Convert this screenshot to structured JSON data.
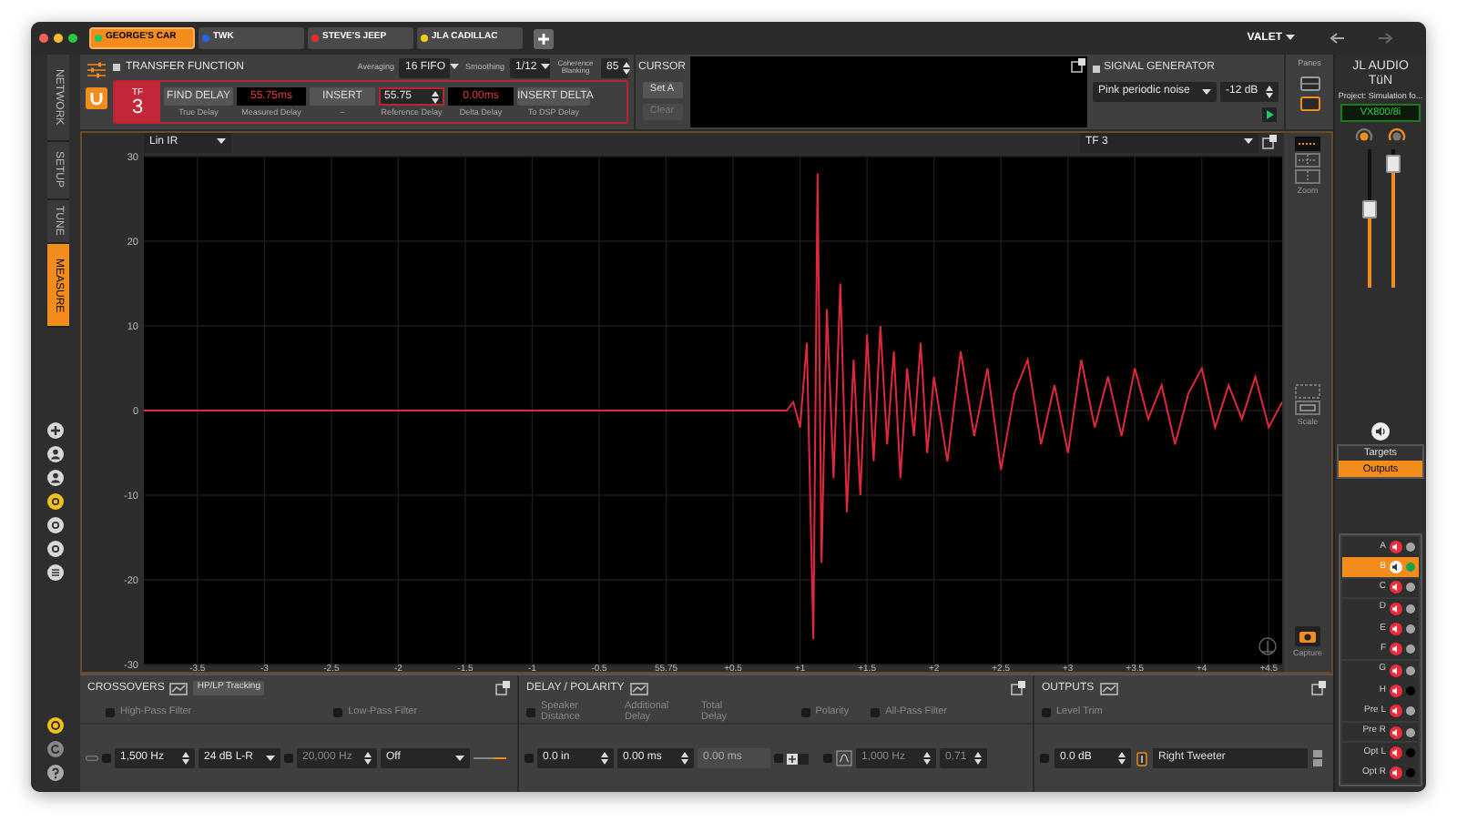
{
  "tabs": [
    {
      "label": "GEORGE'S CAR",
      "color": "#22c55e",
      "selected": true
    },
    {
      "label": "TWK",
      "color": "#2563eb",
      "selected": false
    },
    {
      "label": "STEVE'S JEEP",
      "color": "#ef2b2b",
      "selected": false
    },
    {
      "label": "JLA CADILLAC",
      "color": "#facc15",
      "selected": false
    }
  ],
  "profile": "VALET",
  "nav_tabs": [
    {
      "label": "NETWORK",
      "selected": false
    },
    {
      "label": "SETUP",
      "selected": false
    },
    {
      "label": "TUNE",
      "selected": false
    },
    {
      "label": "MEASURE",
      "selected": true
    }
  ],
  "transfer_function": {
    "title": "TRANSFER FUNCTION",
    "averaging_label": "Averaging",
    "averaging": "16 FIFO",
    "smoothing_label": "Smoothing",
    "smoothing": "1/12",
    "coherence_label": "Coherence Blanking",
    "coherence": "85",
    "tf_label": "TF",
    "tf_number": "3",
    "find_delay": {
      "label": "FIND DELAY",
      "caption": "True Delay"
    },
    "measured_delay": {
      "value": "55.75ms",
      "caption": "Measured Delay"
    },
    "insert": {
      "label": "INSERT",
      "caption": "–"
    },
    "reference_delay": {
      "value": "55.75",
      "caption": "Reference Delay"
    },
    "delta_delay": {
      "value": "0.00ms",
      "caption": "Delta Delay"
    },
    "insert_delta": {
      "label": "INSERT DELTA",
      "caption": "To DSP Delay"
    }
  },
  "cursor": {
    "title": "CURSOR",
    "set_a": "Set A",
    "clear": "Clear",
    "clear_disabled": true
  },
  "signal_generator": {
    "title": "SIGNAL GENERATOR",
    "signal": "Pink periodic noise",
    "gain": "-12 dB"
  },
  "panes": {
    "label": "Panes",
    "items": [
      {
        "selected": false
      },
      {
        "selected": true
      }
    ]
  },
  "chart_toolbar": {
    "view": "Lin IR",
    "trace": "TF 3"
  },
  "chart_reference_label": "55.75",
  "chart_data": {
    "type": "line",
    "grid": true,
    "xlim": [
      -3.9,
      4.6
    ],
    "ylim": [
      -30,
      30
    ],
    "xticks": [
      -3.5,
      -3,
      -2.5,
      -2,
      -1.5,
      -1,
      -0.5,
      {
        "value": 0.5,
        "label": "+0.5"
      },
      {
        "value": 1,
        "label": "+1"
      },
      {
        "value": 1.5,
        "label": "+1.5"
      },
      {
        "value": 2,
        "label": "+2"
      },
      {
        "value": 2.5,
        "label": "+2.5"
      },
      {
        "value": 3,
        "label": "+3"
      },
      {
        "value": 3.5,
        "label": "+3.5"
      },
      {
        "value": 4,
        "label": "+4"
      },
      {
        "value": 4.5,
        "label": "+4.5"
      }
    ],
    "yticks": [
      30,
      20,
      10,
      0,
      -10,
      -20,
      -30
    ],
    "x": [
      -3.9,
      0.9,
      0.95,
      1.0,
      1.05,
      1.1,
      1.13,
      1.16,
      1.2,
      1.25,
      1.3,
      1.35,
      1.4,
      1.45,
      1.5,
      1.55,
      1.6,
      1.65,
      1.7,
      1.75,
      1.8,
      1.85,
      1.9,
      1.95,
      2.0,
      2.1,
      2.2,
      2.3,
      2.4,
      2.5,
      2.6,
      2.7,
      2.8,
      2.9,
      3.0,
      3.1,
      3.2,
      3.3,
      3.4,
      3.5,
      3.6,
      3.7,
      3.8,
      3.9,
      4.0,
      4.1,
      4.2,
      4.3,
      4.4,
      4.5,
      4.6
    ],
    "series": [
      {
        "color": "#e0283c",
        "values": [
          0,
          0,
          1,
          -2,
          8,
          -27,
          28,
          -18,
          12,
          -8,
          15,
          -12,
          6,
          -10,
          9,
          -6,
          10,
          -4,
          7,
          -8,
          5,
          -3,
          8,
          -5,
          4,
          -6,
          7,
          -3,
          5,
          -7,
          2,
          6,
          -4,
          3,
          -5,
          6,
          -2,
          4,
          -3,
          5,
          -1,
          3,
          -4,
          2,
          5,
          -2,
          3,
          -1,
          4,
          -2,
          1
        ]
      }
    ]
  },
  "chart_tools": {
    "zoom_label": "Zoom",
    "scale_label": "Scale",
    "capture_label": "Capture"
  },
  "device": {
    "brand": "JL AUDIO",
    "product": "TüN",
    "project": "Project: Simulation fo...",
    "model": "VX800/8i"
  },
  "faders": [
    {
      "level": 0.56
    },
    {
      "level": 0.9
    }
  ],
  "view_toggle": [
    {
      "label": "Targets",
      "selected": false
    },
    {
      "label": "Outputs",
      "selected": true
    }
  ],
  "channels": [
    {
      "name": "A",
      "selected": false,
      "muted": true,
      "color": "#a3a3a3"
    },
    {
      "name": "B",
      "selected": true,
      "muted": false,
      "color": "#16a34a"
    },
    {
      "name": "C",
      "selected": false,
      "muted": true,
      "color": "#a3a3a3"
    },
    {
      "name": "D",
      "selected": false,
      "muted": true,
      "color": "#a3a3a3"
    },
    {
      "name": "E",
      "selected": false,
      "muted": true,
      "color": "#a3a3a3"
    },
    {
      "name": "F",
      "selected": false,
      "muted": true,
      "color": "#a3a3a3"
    },
    {
      "name": "G",
      "selected": false,
      "muted": true,
      "color": "#a3a3a3"
    },
    {
      "name": "H",
      "selected": false,
      "muted": true,
      "color": "#000000"
    },
    {
      "name": "Pre L",
      "selected": false,
      "muted": true,
      "color": "#a3a3a3"
    },
    {
      "name": "Pre R",
      "selected": false,
      "muted": true,
      "color": "#a3a3a3"
    },
    {
      "name": "Opt L",
      "selected": false,
      "muted": true,
      "color": "#000000"
    },
    {
      "name": "Opt R",
      "selected": false,
      "muted": true,
      "color": "#000000"
    }
  ],
  "crossovers": {
    "title": "CROSSOVERS",
    "tracking": "HP/LP Tracking",
    "high_pass": {
      "label": "High-Pass Filter",
      "checked": false,
      "frequency": "1,500 Hz",
      "slope": "24 dB L-R"
    },
    "low_pass": {
      "label": "Low-Pass Filter",
      "checked": false,
      "frequency": "20,000 Hz",
      "slope": "Off"
    }
  },
  "delay_polarity": {
    "title": "DELAY / POLARITY",
    "speaker_distance_label": "Speaker Distance",
    "additional_delay_label": "Additional Delay",
    "total_delay_label": "Total Delay",
    "polarity_label": "Polarity",
    "all_pass_label": "All-Pass Filter",
    "speaker_distance": "0.0 in",
    "additional_delay": "0.00 ms",
    "total_delay": "0.00 ms",
    "all_pass_frequency": "1,000 Hz",
    "all_pass_q": "0.71"
  },
  "outputs": {
    "title": "OUTPUTS",
    "level_trim_label": "Level Trim",
    "level_trim": "0.0 dB",
    "output_name": "Right Tweeter"
  }
}
